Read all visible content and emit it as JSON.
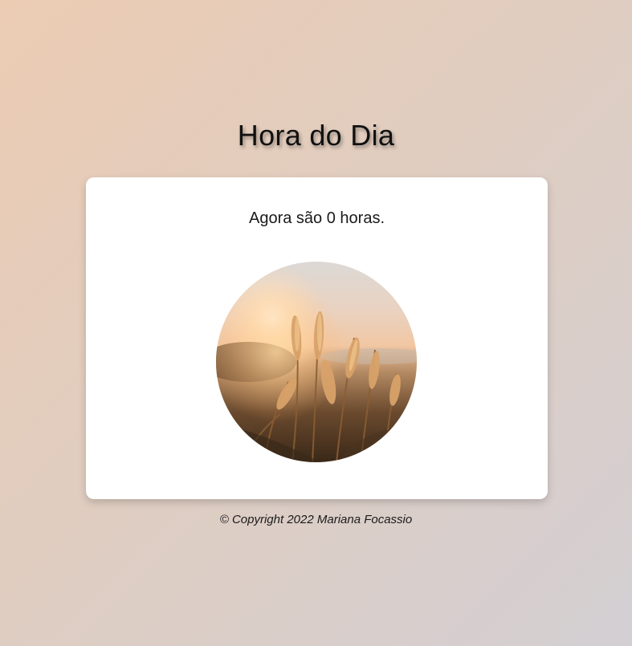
{
  "header": {
    "title": "Hora do Dia"
  },
  "card": {
    "message": "Agora são 0 horas.",
    "image_subject": "wheat-field-sunrise"
  },
  "footer": {
    "copyright": "© Copyright 2022 Mariana Focassio"
  },
  "colors": {
    "background_start": "#ecccb3",
    "background_end": "#d3cfd3",
    "card": "#ffffff",
    "text": "#111111"
  }
}
